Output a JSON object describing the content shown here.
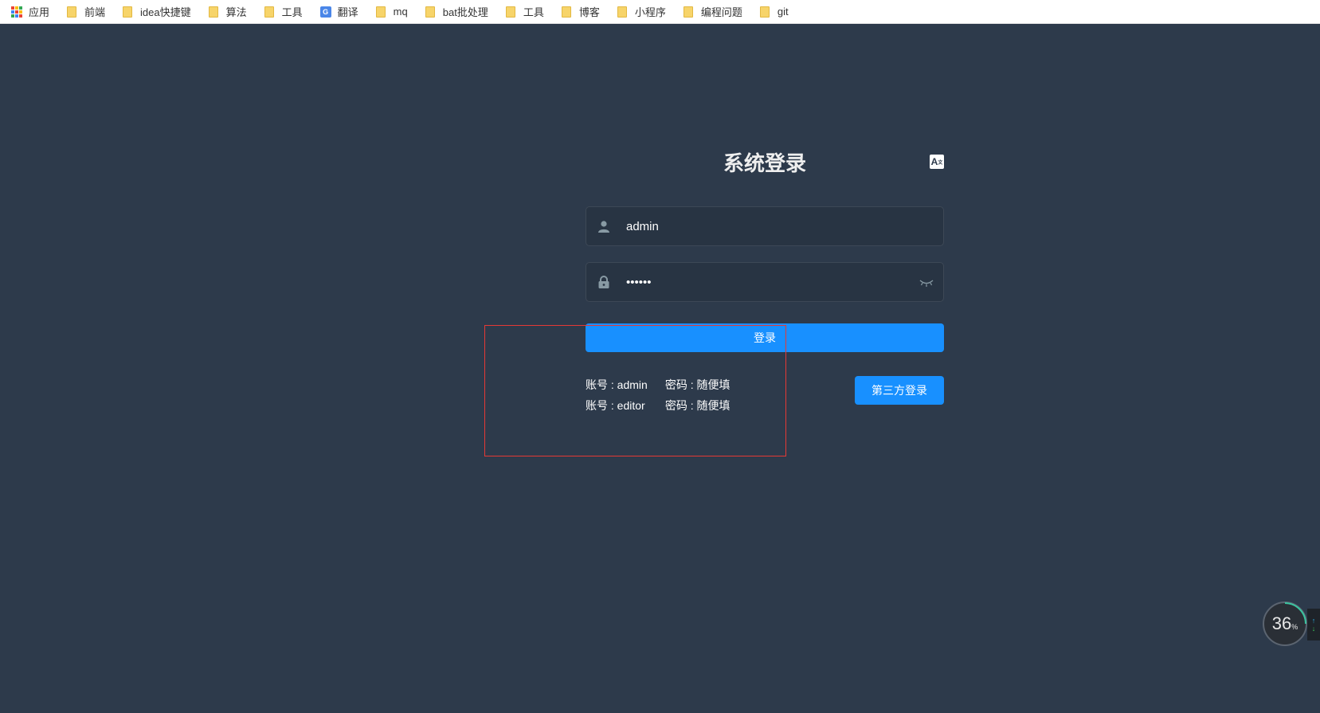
{
  "bookmarks": [
    {
      "label": "应用",
      "icon": "apps-icon"
    },
    {
      "label": "前端",
      "icon": "folder-icon"
    },
    {
      "label": "idea快捷键",
      "icon": "folder-icon"
    },
    {
      "label": "算法",
      "icon": "folder-icon"
    },
    {
      "label": "工具",
      "icon": "folder-icon"
    },
    {
      "label": "翻译",
      "icon": "translate-icon"
    },
    {
      "label": "mq",
      "icon": "folder-icon"
    },
    {
      "label": "bat批处理",
      "icon": "folder-icon"
    },
    {
      "label": "工具",
      "icon": "folder-icon"
    },
    {
      "label": "博客",
      "icon": "folder-icon"
    },
    {
      "label": "小程序",
      "icon": "folder-icon"
    },
    {
      "label": "编程问题",
      "icon": "folder-icon"
    },
    {
      "label": "git",
      "icon": "folder-icon"
    }
  ],
  "login": {
    "title": "系统登录",
    "lang_icon": "translate-icon",
    "username": {
      "value": "admin",
      "icon": "user-icon"
    },
    "password": {
      "value": "••••••",
      "icon": "lock-icon",
      "toggle_icon": "eye-closed-icon"
    },
    "submit_label": "登录",
    "tips": [
      {
        "account": "账号 : admin",
        "password": "密码 : 随便填"
      },
      {
        "account": "账号 : editor",
        "password": "密码 : 随便填"
      }
    ],
    "third_party_label": "第三方登录"
  },
  "speed_widget": {
    "value": "36",
    "unit": "%",
    "colors": {
      "up": "#2ab0e6",
      "down": "#3bc45a"
    }
  },
  "colors": {
    "background": "#2d3a4b",
    "accent": "#1890ff",
    "highlight_box": "#e53935"
  }
}
